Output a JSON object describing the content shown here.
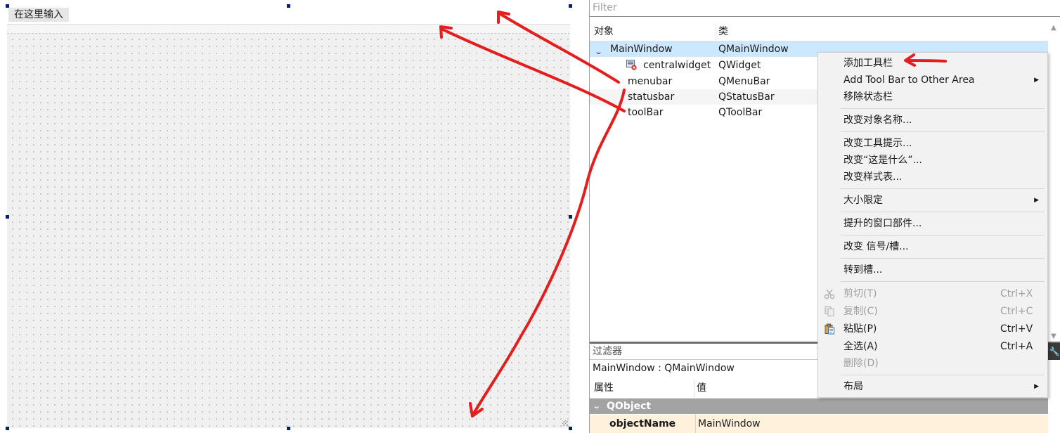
{
  "designer": {
    "menubar_placeholder": "在这里输入"
  },
  "object_inspector": {
    "filter_placeholder": "Filter",
    "columns": [
      "对象",
      "类"
    ],
    "rows": [
      {
        "object": "MainWindow",
        "class": "QMainWindow"
      },
      {
        "object": "centralwidget",
        "class": "QWidget"
      },
      {
        "object": "menubar",
        "class": "QMenuBar"
      },
      {
        "object": "statusbar",
        "class": "QStatusBar"
      },
      {
        "object": "toolBar",
        "class": "QToolBar"
      }
    ]
  },
  "property_editor": {
    "filter_placeholder": "过滤器",
    "context": "MainWindow : QMainWindow",
    "columns": [
      "属性",
      "值"
    ],
    "group": "QObject",
    "rows": [
      {
        "name": "objectName",
        "value": "MainWindow"
      }
    ]
  },
  "context_menu": {
    "items": [
      {
        "label": "添加工具栏"
      },
      {
        "label": "Add Tool Bar to Other Area",
        "submenu": true
      },
      {
        "label": "移除状态栏"
      },
      {
        "label": "改变对象名称..."
      },
      {
        "label": "改变工具提示..."
      },
      {
        "label": "改变“这是什么”..."
      },
      {
        "label": "改变样式表..."
      },
      {
        "label": "大小限定",
        "submenu": true
      },
      {
        "label": "提升的窗口部件..."
      },
      {
        "label": "改变 信号/槽..."
      },
      {
        "label": "转到槽..."
      },
      {
        "label": "剪切(T)",
        "shortcut": "Ctrl+X",
        "enabled": false,
        "icon": "scissors-icon"
      },
      {
        "label": "复制(C)",
        "shortcut": "Ctrl+C",
        "enabled": false,
        "icon": "copy-icon"
      },
      {
        "label": "粘贴(P)",
        "shortcut": "Ctrl+V",
        "enabled": true,
        "icon": "paste-icon"
      },
      {
        "label": "全选(A)",
        "shortcut": "Ctrl+A",
        "enabled": true
      },
      {
        "label": "删除(D)",
        "enabled": false
      },
      {
        "label": "布局",
        "submenu": true
      }
    ]
  },
  "colors": {
    "annotation": "#e31e1e",
    "selection": "#cce8ff",
    "handle": "#0a1e6e",
    "group_header": "#a3a3a3",
    "property_row": "#fff1dc"
  }
}
